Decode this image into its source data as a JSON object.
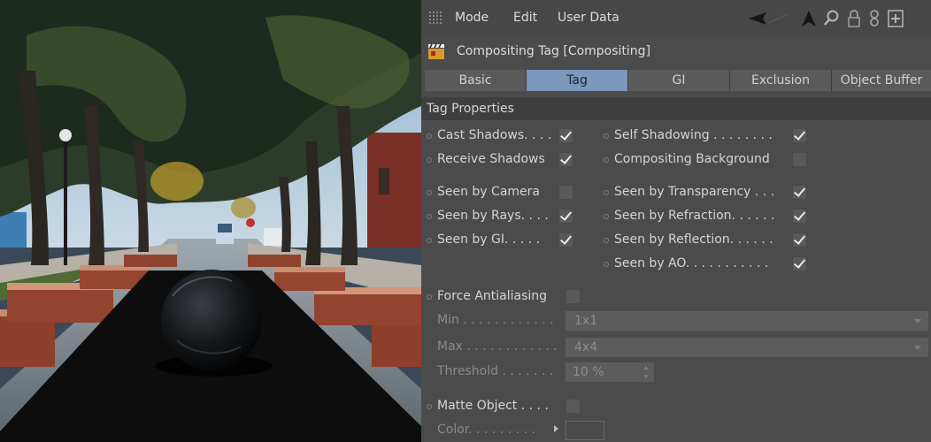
{
  "menu": {
    "mode": "Mode",
    "edit": "Edit",
    "user_data": "User Data"
  },
  "object": {
    "title": "Compositing Tag [Compositing]"
  },
  "tabs": [
    {
      "label": "Basic",
      "active": false
    },
    {
      "label": "Tag",
      "active": true
    },
    {
      "label": "GI",
      "active": false
    },
    {
      "label": "Exclusion",
      "active": false
    },
    {
      "label": "Object Buffer",
      "active": false
    }
  ],
  "section": {
    "title": "Tag Properties"
  },
  "props": {
    "cast_shadows": {
      "label": "Cast Shadows. . . .",
      "checked": true
    },
    "receive_shadows": {
      "label": "Receive Shadows",
      "checked": true
    },
    "seen_by_camera": {
      "label": "Seen by Camera",
      "checked": false
    },
    "seen_by_rays": {
      "label": "Seen by Rays. . . .",
      "checked": true
    },
    "seen_by_gi": {
      "label": "Seen by GI. . . . .",
      "checked": true
    },
    "self_shadowing": {
      "label": "Self Shadowing . . . . . . . .",
      "checked": true
    },
    "compositing_background": {
      "label": "Compositing Background",
      "checked": false
    },
    "seen_by_transparency": {
      "label": "Seen by Transparency . . .",
      "checked": true
    },
    "seen_by_refraction": {
      "label": "Seen by Refraction. . . . . .",
      "checked": true
    },
    "seen_by_reflection": {
      "label": "Seen by Reflection. . . . . .",
      "checked": true
    },
    "seen_by_ao": {
      "label": "Seen by AO. . . . . . . . . . .",
      "checked": true
    },
    "force_antialiasing": {
      "label": "Force Antialiasing",
      "checked": false
    },
    "min": {
      "label": "Min . . . . . . . . . . . .",
      "value": "1x1"
    },
    "max": {
      "label": "Max . . . . . . . . . . . .",
      "value": "4x4"
    },
    "threshold": {
      "label": "Threshold . . . . . . .",
      "value": "10 %"
    },
    "matte_object": {
      "label": "Matte Object . . . .",
      "checked": false
    },
    "color": {
      "label": "Color. . . . . . . . ."
    }
  },
  "icons": {
    "back": "arrow-left-icon",
    "up": "arrow-up-icon",
    "search": "search-icon",
    "lock": "lock-icon",
    "link": "link-icon",
    "new_panel": "new-panel-icon",
    "tag": "clapperboard-icon"
  },
  "colors": {
    "panel_bg": "#4b4b4b",
    "active_tab": "#7b98bd",
    "check": "#eaeaea"
  }
}
